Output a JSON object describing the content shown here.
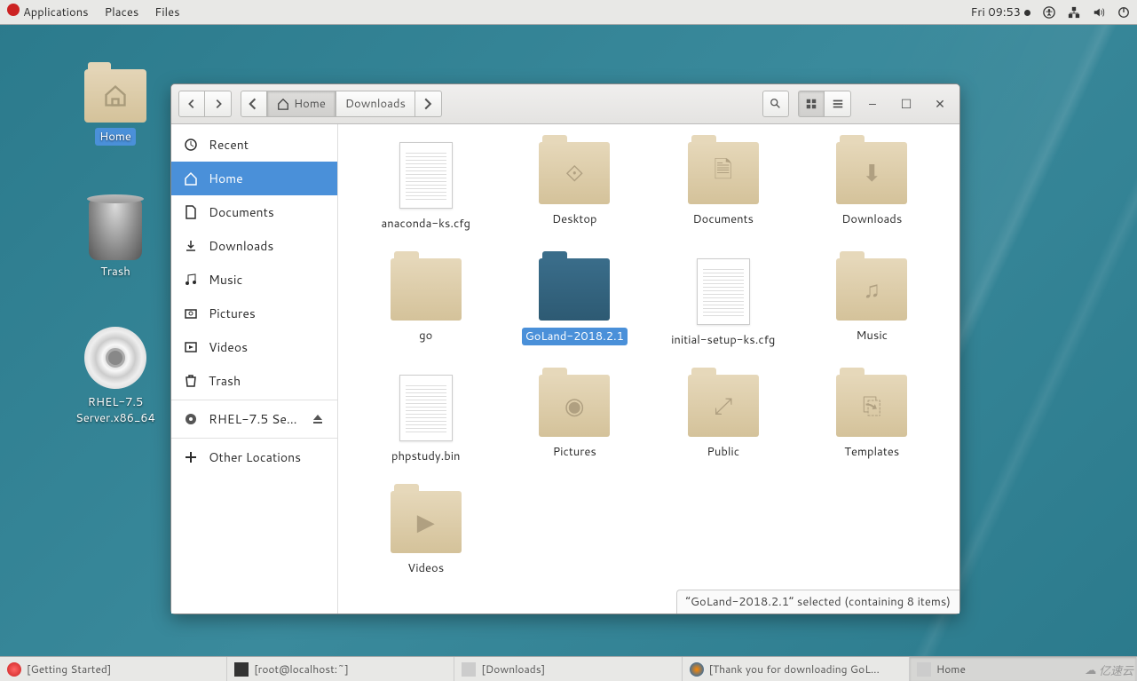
{
  "topbar": {
    "menus": [
      "Applications",
      "Places",
      "Files"
    ],
    "clock": "Fri 09:53"
  },
  "desktop_icons": {
    "home": "Home",
    "trash": "Trash",
    "cd": "RHEL-7.5 Server.x86_64"
  },
  "fm": {
    "path": {
      "home": "Home",
      "downloads": "Downloads"
    },
    "sidebar": {
      "recent": "Recent",
      "home": "Home",
      "documents": "Documents",
      "downloads": "Downloads",
      "music": "Music",
      "pictures": "Pictures",
      "videos": "Videos",
      "trash": "Trash",
      "rhel": "RHEL-7.5 Se...",
      "other": "Other Locations"
    },
    "items": {
      "anaconda": "anaconda-ks.cfg",
      "desktop": "Desktop",
      "documents": "Documents",
      "downloads": "Downloads",
      "go": "go",
      "goland": "GoLand-2018.2.1",
      "initial": "initial-setup-ks.cfg",
      "music": "Music",
      "phpstudy": "phpstudy.bin",
      "pictures": "Pictures",
      "public": "Public",
      "templates": "Templates",
      "videos": "Videos"
    },
    "status": "“GoLand-2018.2.1” selected  (containing 8 items)"
  },
  "taskbar": {
    "t1": "[Getting Started]",
    "t2": "[root@localhost:~]",
    "t3": "[Downloads]",
    "t4": "[Thank you for downloading GoL...",
    "t5": "Home"
  },
  "watermark": "亿速云"
}
